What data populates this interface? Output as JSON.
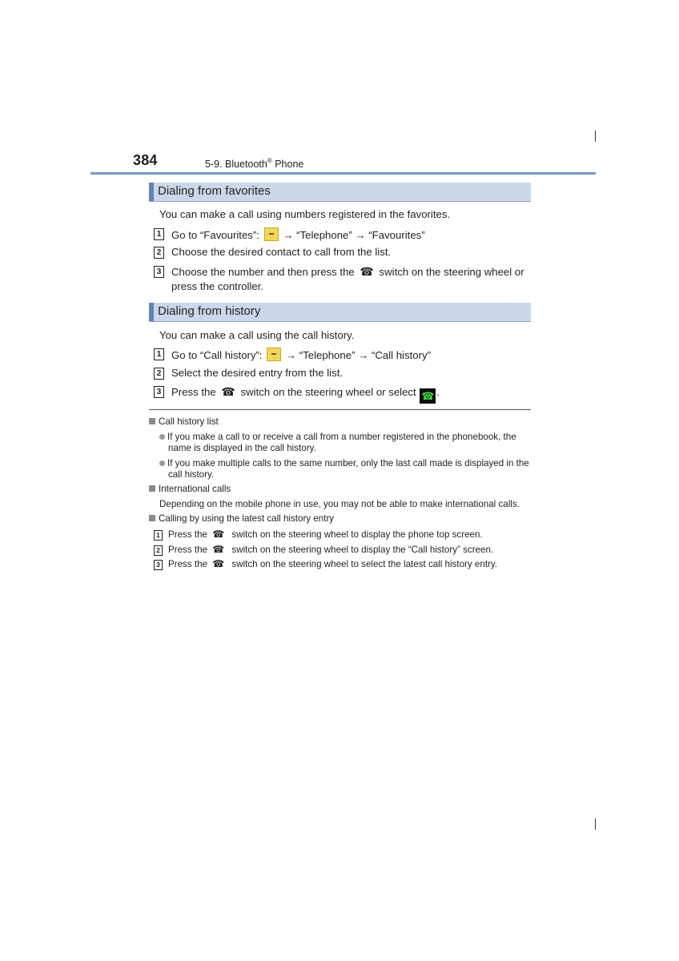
{
  "header": {
    "page_number": "384",
    "chapter": "5-9. Bluetooth",
    "chapter_reg": "®",
    "chapter_suffix": " Phone"
  },
  "sections": [
    {
      "title": "Dialing from favorites",
      "intro": "You can make a call using numbers registered in the favorites.",
      "steps": [
        {
          "num": "1",
          "before": "Go to “Favourites”:",
          "icon": "menu-button-icon",
          "after": "→ “Telephone” → “Favourites”"
        },
        {
          "num": "2",
          "text": "Choose the desired contact to call from the list."
        },
        {
          "num": "3",
          "before": "Choose the number and then press the",
          "icon": "phone-switch-icon",
          "after": "switch on the steering wheel or",
          "cont": "press the controller."
        }
      ]
    },
    {
      "title": "Dialing from history",
      "intro": "You can make a call using the call history.",
      "steps": [
        {
          "num": "1",
          "before": "Go to “Call history”:",
          "icon": "menu-button-icon",
          "after": "→ “Telephone” → “Call history”"
        },
        {
          "num": "2",
          "text": "Select the desired entry from the list."
        },
        {
          "num": "3",
          "before": "Press the",
          "icon": "phone-switch-icon",
          "after": "switch on the steering wheel or select",
          "icon2": "call-button-icon",
          "end": "."
        }
      ]
    }
  ],
  "notes": [
    {
      "title": "Call history list",
      "bullets": [
        {
          "line1": "If you make a call to or receive a call from a number registered in the phonebook, the",
          "line2": "name is displayed in the call history."
        },
        {
          "line1": "If you make multiple calls to the same number, only the last call made is displayed in the",
          "line2": "call history."
        }
      ]
    },
    {
      "title": "International calls",
      "text": "Depending on the mobile phone in use, you may not be able to make international calls."
    },
    {
      "title": "Calling by using the latest call history entry",
      "steps": [
        {
          "num": "1",
          "before": "Press the",
          "after": "switch on the steering wheel to display the phone top screen."
        },
        {
          "num": "2",
          "before": "Press the",
          "after": "switch on the steering wheel to display the “Call history” screen."
        },
        {
          "num": "3",
          "before": "Press the",
          "after": "switch on the steering wheel to select the latest call history entry."
        }
      ]
    }
  ],
  "icons": {
    "phone_glyph": "☎",
    "call_glyph": "☎"
  },
  "colors": {
    "section_band": "#cbd8ea",
    "section_accent": "#5f83b8",
    "header_rule": "#7b97c0",
    "menu_button": "#f2d75b",
    "call_button_bg": "#0d0d0d",
    "call_button_fg": "#46d14a"
  }
}
